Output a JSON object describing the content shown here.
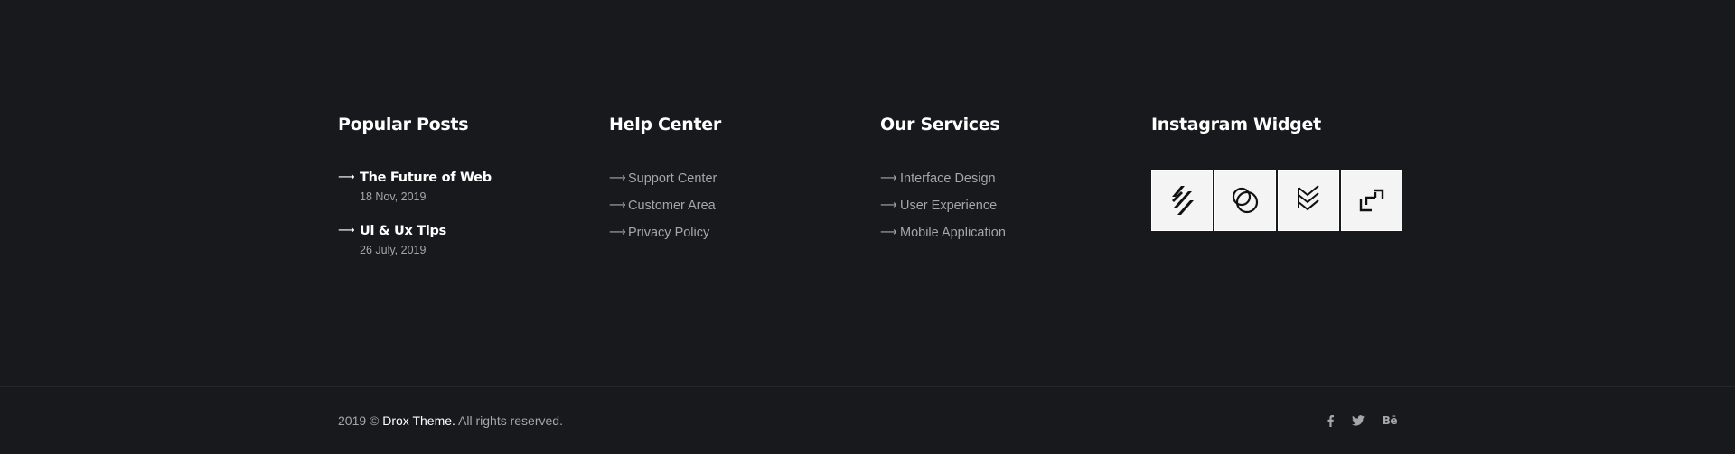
{
  "popular_posts": {
    "title": "Popular Posts",
    "posts": [
      {
        "title": "The Future of Web",
        "date": "18 Nov, 2019"
      },
      {
        "title": "Ui & Ux Tips",
        "date": "26 July, 2019"
      }
    ]
  },
  "help_center": {
    "title": "Help Center",
    "links": [
      "Support Center",
      "Customer Area",
      "Privacy Policy"
    ]
  },
  "our_services": {
    "title": "Our Services",
    "links": [
      "Interface Design",
      "User Experience",
      "Mobile Application"
    ]
  },
  "instagram": {
    "title": "Instagram Widget",
    "tiles": [
      "slash-lines-logo-icon",
      "overlapping-circles-logo-icon",
      "stacked-chevrons-logo-icon",
      "corner-brackets-logo-icon"
    ]
  },
  "bottom": {
    "copyright_prefix": "2019 © ",
    "brand": "Drox Theme.",
    "copyright_suffix": " All rights reserved.",
    "social": [
      "facebook-icon",
      "twitter-icon",
      "behance-icon"
    ],
    "behance_label": "Bē"
  },
  "colors": {
    "background": "#18191d",
    "text_muted": "#a5a6aa",
    "heading": "#ffffff",
    "tile": "#f4f4f4"
  },
  "arrow_glyph": "⟶"
}
